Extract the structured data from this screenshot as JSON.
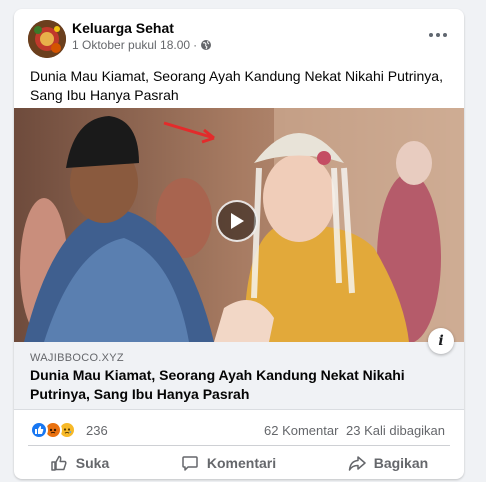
{
  "post": {
    "page_name": "Keluarga Sehat",
    "timestamp": "1 Oktober pukul 18.00",
    "separator": "·",
    "text": "Dunia Mau Kiamat, Seorang Ayah Kandung Nekat Nikahi Putrinya, Sang Ibu Hanya Pasrah"
  },
  "link": {
    "domain": "WAJIBBOCO.XYZ",
    "title": "Dunia Mau Kiamat, Seorang Ayah Kandung Nekat Nikahi Putrinya, Sang Ibu Hanya Pasrah",
    "info_glyph": "i"
  },
  "stats": {
    "reaction_icons": [
      "like-icon",
      "angry-icon",
      "sad-icon"
    ],
    "reaction_count": "236",
    "comments": "62 Komentar",
    "shares": "23 Kali dibagikan"
  },
  "actions": {
    "like": "Suka",
    "comment": "Komentari",
    "share": "Bagikan"
  },
  "colors": {
    "like": "#1877f2",
    "angry": "#e9710f",
    "sad": "#f7b928",
    "meta_text": "#65676b"
  }
}
